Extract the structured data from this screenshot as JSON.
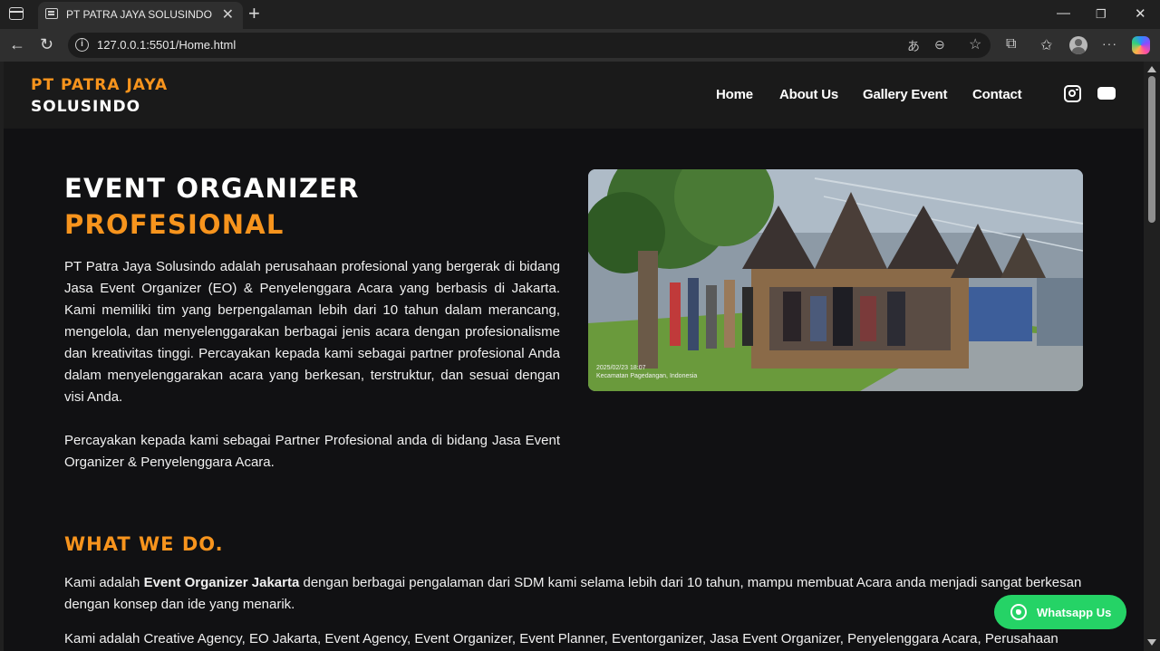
{
  "browser": {
    "tab_title": "PT PATRA JAYA SOLUSINDO",
    "url": "127.0.0.1:5501/Home.html"
  },
  "site": {
    "logo_line1": "PT PATRA JAYA",
    "logo_line2": "SOLUSINDO",
    "nav": {
      "home": "Home",
      "about": "About Us",
      "gallery": "Gallery Event",
      "contact": "Contact"
    },
    "social_icons": [
      "instagram-icon",
      "youtube-icon"
    ]
  },
  "hero": {
    "title_line1": "EVENT ORGANIZER",
    "title_line2": "PROFESIONAL",
    "paragraph1": "PT Patra Jaya Solusindo adalah perusahaan profesional yang bergerak di bidang Jasa Event Organizer (EO) & Penyelenggara Acara yang berbasis di Jakarta. Kami memiliki tim yang berpengalaman lebih dari 10 tahun dalam merancang, mengelola, dan menyelenggarakan berbagai jenis acara dengan profesionalisme dan kreativitas tinggi. Percayakan kepada kami sebagai partner profesional Anda dalam menyelenggarakan acara yang berkesan, terstruktur, dan sesuai dengan visi Anda.",
    "paragraph2": "Percayakan kepada kami sebagai Partner Profesional anda di bidang Jasa Event Organizer & Penyelenggara Acara.",
    "image_stamp_line1": "2025/02/23 18:07",
    "image_stamp_line2": "Kecamatan Pagedangan, Indonesia"
  },
  "what_we_do": {
    "title": "WHAT WE DO.",
    "p1_prefix": "Kami adalah ",
    "p1_bold": "Event Organizer Jakarta",
    "p1_suffix": " dengan berbagai pengalaman dari SDM kami selama lebih dari 10 tahun, mampu membuat Acara anda menjadi sangat berkesan dengan konsep dan ide yang menarik.",
    "p2": "Kami adalah Creative Agency, EO Jakarta, Event Agency, Event Organizer, Event Planner, Eventorganizer, Jasa Event Organizer, Penyelenggara Acara, Perusahaan Event"
  },
  "whatsapp": {
    "label": "Whatsapp Us"
  },
  "colors": {
    "accent": "#f7941d",
    "page_bg": "#111113",
    "header_bg": "#1a1a1a",
    "whatsapp": "#25d366"
  }
}
